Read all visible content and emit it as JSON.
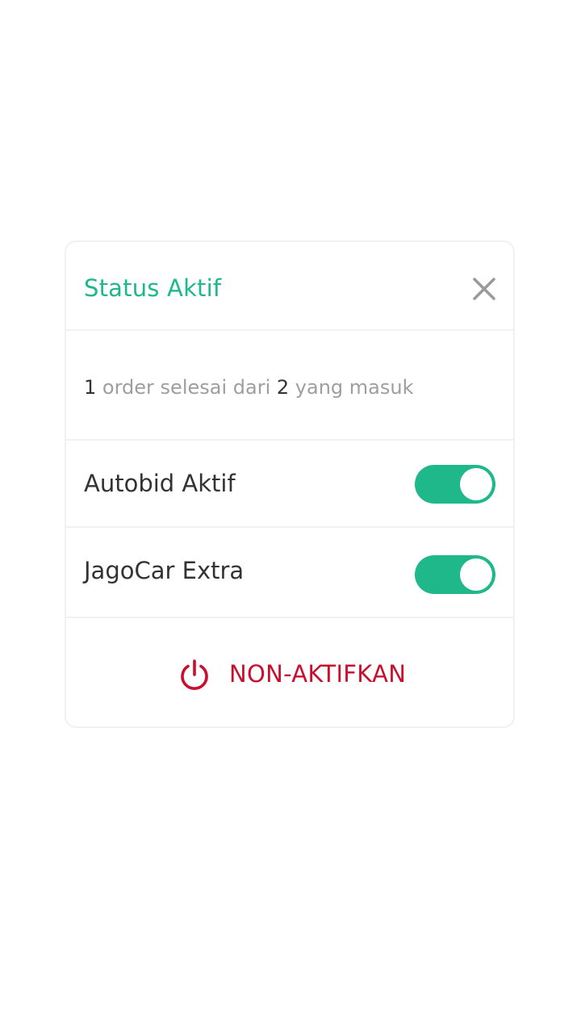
{
  "dialog": {
    "title": "Status Aktif",
    "close_icon": "close-icon"
  },
  "summary": {
    "completed": "1",
    "text_mid": "order selesai dari",
    "incoming": "2",
    "text_end": "yang masuk"
  },
  "settings": [
    {
      "label": "Autobid Aktif",
      "enabled": true
    },
    {
      "label": "JagoCar Extra",
      "enabled": true
    }
  ],
  "action": {
    "label": "NON-AKTIFKAN",
    "icon": "power-icon"
  },
  "colors": {
    "accent": "#1fb88a",
    "danger": "#c8102e",
    "text": "#333333",
    "muted": "#9e9e9e"
  }
}
